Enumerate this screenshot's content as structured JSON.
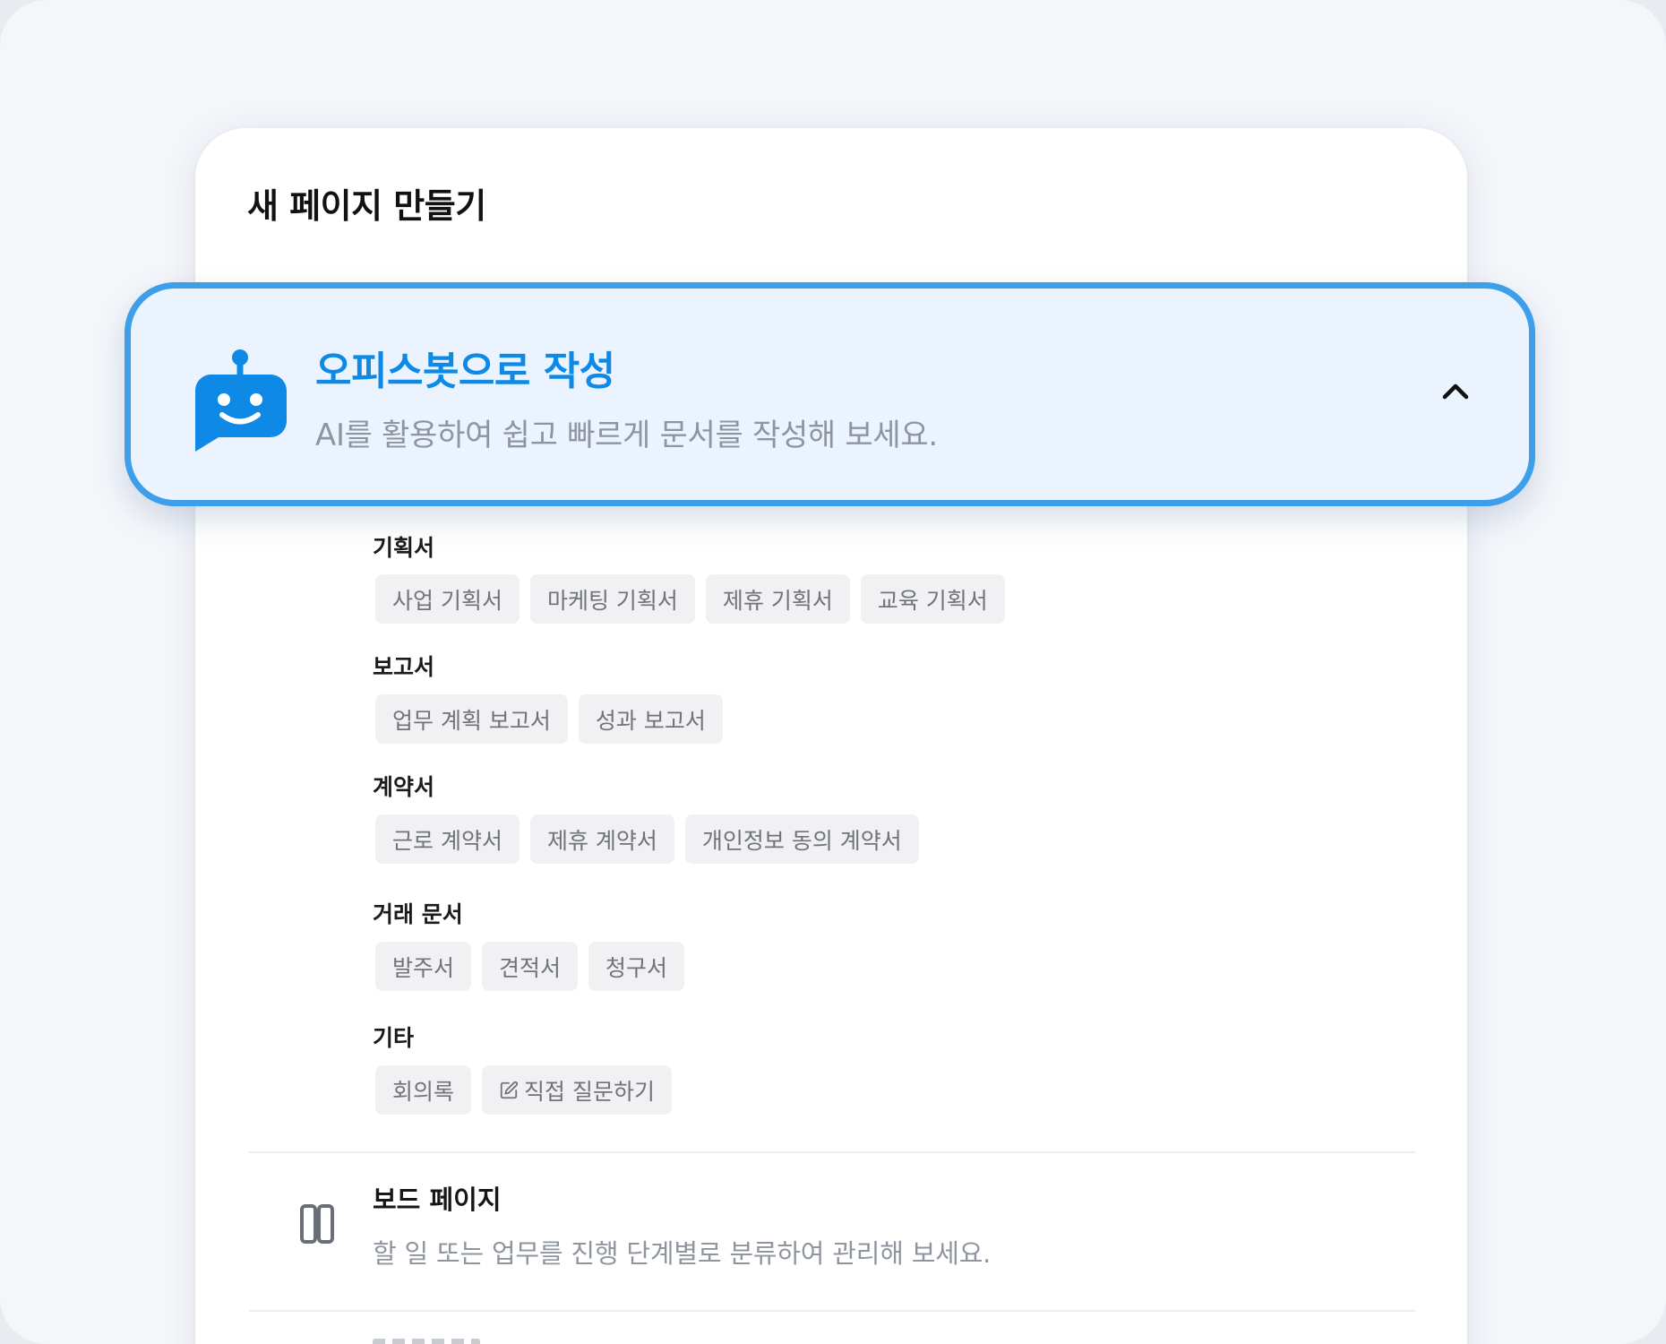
{
  "panel": {
    "title": "새 페이지 만들기"
  },
  "officebot": {
    "title": "오피스봇으로 작성",
    "subtitle": "AI를 활용하여 쉽고 빠르게 문서를 작성해 보세요.",
    "icon": "robot-chat-icon",
    "collapse_icon": "chevron-up-icon",
    "accent_color": "#0e8ae6",
    "border_color": "#3d9ee9"
  },
  "categories": [
    {
      "label": "기획서",
      "chips": [
        "사업 기획서",
        "마케팅 기획서",
        "제휴 기획서",
        "교육 기획서"
      ]
    },
    {
      "label": "보고서",
      "chips": [
        "업무 계획 보고서",
        "성과 보고서"
      ]
    },
    {
      "label": "계약서",
      "chips": [
        "근로 계약서",
        "제휴 계약서",
        "개인정보 동의 계약서"
      ]
    },
    {
      "label": "거래 문서",
      "chips": [
        "발주서",
        "견적서",
        "청구서"
      ]
    },
    {
      "label": "기타",
      "chips": [
        "회의록",
        "직접 질문하기"
      ]
    }
  ],
  "board": {
    "title": "보드 페이지",
    "subtitle": "할 일 또는 업무를 진행 단계별로 분류하여 관리해 보세요.",
    "icon": "board-columns-icon"
  }
}
